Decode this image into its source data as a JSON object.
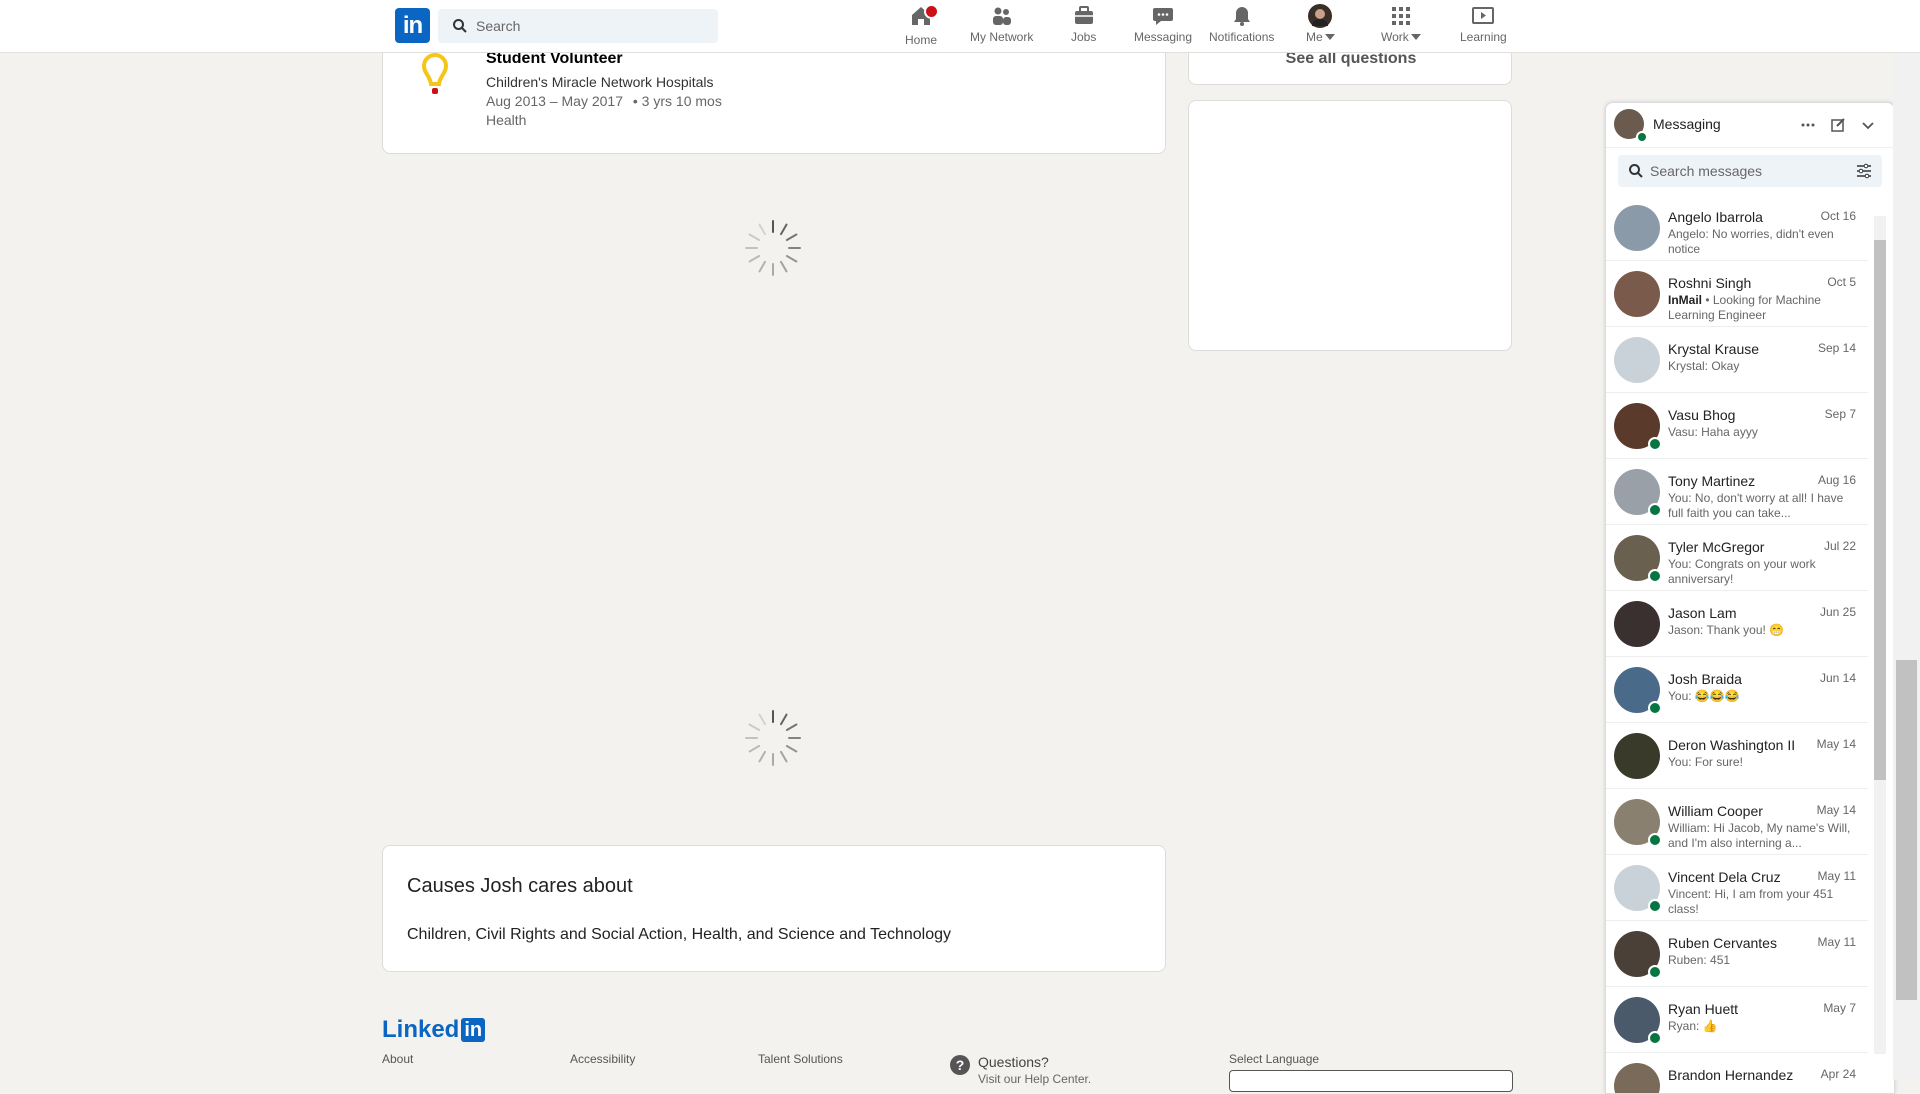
{
  "nav": {
    "search_placeholder": "Search",
    "items": [
      {
        "label": "Home",
        "icon": "home-icon"
      },
      {
        "label": "My Network",
        "icon": "network-icon"
      },
      {
        "label": "Jobs",
        "icon": "jobs-icon"
      },
      {
        "label": "Messaging",
        "icon": "messaging-icon"
      },
      {
        "label": "Notifications",
        "icon": "bell-icon"
      },
      {
        "label": "Me",
        "icon": "avatar"
      },
      {
        "label": "Work",
        "icon": "grid-icon"
      },
      {
        "label": "Learning",
        "icon": "learning-icon"
      }
    ]
  },
  "volunteer": {
    "title": "Student Volunteer",
    "org": "Children's Miracle Network Hospitals",
    "dates": "Aug 2013 – May 2017",
    "duration": "• 3 yrs 10 mos",
    "cause": "Health"
  },
  "causes": {
    "title": "Causes Josh cares about",
    "text": "Children, Civil Rights and Social Action, Health, and Science and Technology"
  },
  "sidebar": {
    "see_all": "See all questions"
  },
  "footer": {
    "logo_text": "Linked",
    "logo_in": "in",
    "links": [
      "About",
      "Accessibility",
      "Talent Solutions"
    ],
    "questions": "Questions?",
    "questions_sub": "Visit our Help Center.",
    "select_language": "Select Language"
  },
  "messaging": {
    "title": "Messaging",
    "search_placeholder": "Search messages",
    "conversations": [
      {
        "name": "Angelo Ibarrola",
        "date": "Oct 16",
        "snippet": "Angelo: No worries, didn't even notice",
        "online": false,
        "color": "#8a9aa8"
      },
      {
        "name": "Roshni Singh",
        "date": "Oct 5",
        "inmail": "InMail",
        "snippet": " • Looking for Machine Learning Engineer",
        "online": false,
        "color": "#7a5a4a"
      },
      {
        "name": "Krystal Krause",
        "date": "Sep 14",
        "snippet": "Krystal: Okay",
        "online": false,
        "color": "#c9d1d9"
      },
      {
        "name": "Vasu Bhog",
        "date": "Sep 7",
        "snippet": "Vasu: Haha ayyy",
        "online": true,
        "color": "#5a3a2a"
      },
      {
        "name": "Tony Martinez",
        "date": "Aug 16",
        "snippet": "You: No, don't worry at all! I have full faith you can take...",
        "online": true,
        "color": "#9aa0a8"
      },
      {
        "name": "Tyler McGregor",
        "date": "Jul 22",
        "snippet": "You: Congrats on your work anniversary!",
        "online": true,
        "color": "#6a6050"
      },
      {
        "name": "Jason Lam",
        "date": "Jun 25",
        "snippet": "Jason: Thank you! 😁",
        "online": false,
        "color": "#3a3030"
      },
      {
        "name": "Josh Braida",
        "date": "Jun 14",
        "snippet": "You: 😂😂😂",
        "online": true,
        "color": "#4a6a8a"
      },
      {
        "name": "Deron Washington II",
        "date": "May 14",
        "snippet": "You: For sure!",
        "online": false,
        "color": "#3a3a2a"
      },
      {
        "name": "William Cooper",
        "date": "May 14",
        "snippet": "William: Hi Jacob, My name's Will, and I'm also interning a...",
        "online": true,
        "color": "#8a8070"
      },
      {
        "name": "Vincent Dela Cruz",
        "date": "May 11",
        "snippet": "Vincent: Hi, I am from your 451 class!",
        "online": true,
        "color": "#c9d1d9"
      },
      {
        "name": "Ruben Cervantes",
        "date": "May 11",
        "snippet": "Ruben: 451",
        "online": true,
        "color": "#4a4038"
      },
      {
        "name": "Ryan Huett",
        "date": "May 7",
        "snippet": "Ryan: 👍",
        "online": true,
        "color": "#4a5a6a"
      },
      {
        "name": "Brandon Hernandez",
        "date": "Apr 24",
        "snippet": "",
        "online": false,
        "color": "#7a6a5a"
      }
    ]
  }
}
